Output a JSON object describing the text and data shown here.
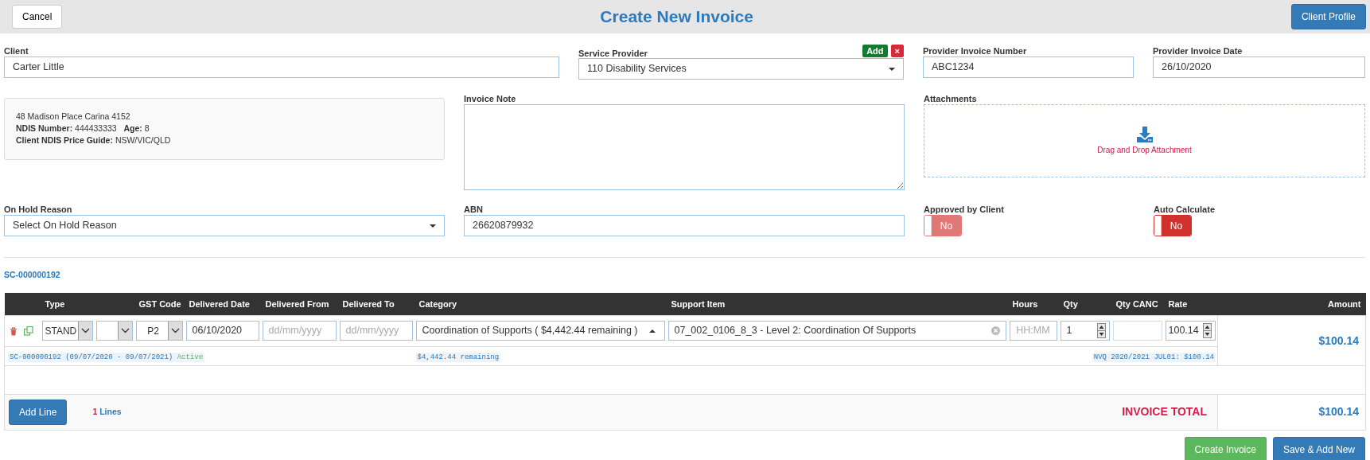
{
  "header": {
    "cancel_button": "Cancel",
    "title": "Create New Invoice",
    "client_profile_button": "Client Profile"
  },
  "client": {
    "label": "Client",
    "value": "Carter Little"
  },
  "service_provider": {
    "label": "Service Provider",
    "value": "110 Disability Services",
    "add_badge": "Add",
    "remove_badge": "×"
  },
  "provider_invoice_number": {
    "label": "Provider Invoice Number",
    "value": "ABC1234"
  },
  "provider_invoice_date": {
    "label": "Provider Invoice Date",
    "value": "26/10/2020"
  },
  "client_info": {
    "address": "48 Madison Place Carina 4152",
    "lines": [
      {
        "label": "NDIS Number:",
        "value": "444433333"
      },
      {
        "label": "Age:",
        "value": "8"
      },
      {
        "label": "Client NDIS Price Guide:",
        "value": "NSW/VIC/QLD"
      }
    ]
  },
  "invoice_note": {
    "label": "Invoice Note"
  },
  "attachments": {
    "label": "Attachments",
    "hint": "Drag and Drop Attachment"
  },
  "on_hold_reason": {
    "label": "On Hold Reason",
    "value": "Select On Hold Reason"
  },
  "abn": {
    "label": "ABN",
    "value": "26620879932"
  },
  "approved_by_client": {
    "label": "Approved by Client",
    "on": false,
    "disabled": true,
    "text": "No"
  },
  "auto_calculate": {
    "label": "Auto Calculate",
    "on": false,
    "disabled": false,
    "text": "No"
  },
  "service_agreement": "SC-000000192",
  "table": {
    "columns": [
      "Type",
      "GST Code",
      "Delivered Date",
      "Delivered From",
      "Delivered To",
      "Category",
      "Support Item",
      "Hours",
      "Qty",
      "Qty CANC",
      "Rate",
      "Amount"
    ],
    "rows": [
      {
        "type": "STAND",
        "gst_code": "P2",
        "delivered_date": "06/10/2020",
        "delivered_from_placeholder": "dd/mm/yyyy",
        "delivered_to_placeholder": "dd/mm/yyyy",
        "category": "Coordination of Supports ( $4,442.44 remaining )",
        "support_item": "07_002_0106_8_3 - Level 2: Coordination Of Supports",
        "hours_placeholder": "HH:MM",
        "qty": "1",
        "rate": "100.14",
        "amount": "$100.14",
        "agreement_note": "SC-000000192 (09/07/2020 - 09/07/2021)",
        "agreement_status": "Active",
        "category_note": "$4,442.44 remaining",
        "price_note": "NVQ 2020/2021 JUL01: $100.14"
      }
    ],
    "footer": {
      "add_line_button": "Add Line",
      "line_count": "1",
      "line_count_label": "Lines",
      "total_label": "INVOICE TOTAL",
      "total": "$100.14"
    }
  },
  "actions": [
    "Create Invoice",
    "Save & Add New"
  ]
}
